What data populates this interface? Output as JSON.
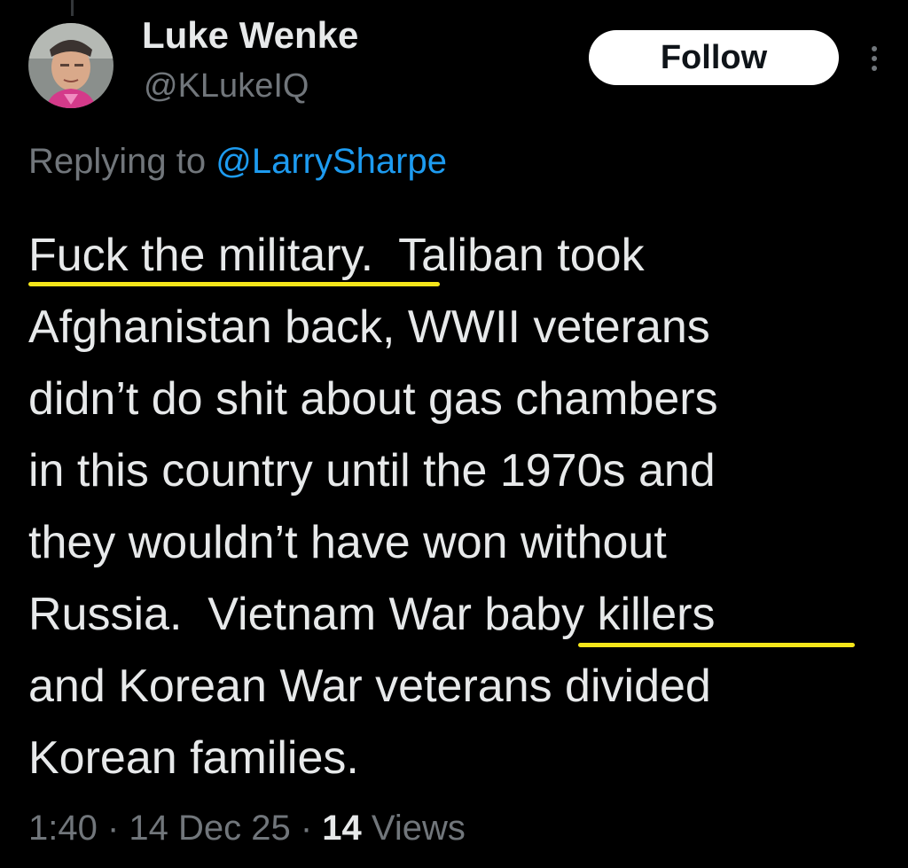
{
  "author": {
    "display_name": "Luke Wenke",
    "handle": "@KLukeIQ",
    "avatar": "profile-photo"
  },
  "actions": {
    "follow_label": "Follow",
    "more_icon": "more-vertical-icon"
  },
  "reply_context": {
    "prefix": "Replying to ",
    "mention": "@LarrySharpe"
  },
  "tweet": {
    "lines": [
      "Fuck the military.  Taliban took",
      "Afghanistan back, WWII veterans",
      "didn’t do shit about gas chambers",
      "in this country until the 1970s and",
      "they wouldn’t have won without",
      "Russia.  Vietnam War baby killers",
      "and Korean War veterans divided",
      "Korean families."
    ],
    "highlighted_phrases": [
      "Fuck the military",
      "baby killers"
    ],
    "highlight_color": "#f5e61a"
  },
  "meta": {
    "time": "1:40",
    "separator": " · ",
    "date": "14 Dec 25",
    "views_count": "14",
    "views_label": " Views"
  },
  "colors": {
    "background": "#000000",
    "text_primary": "#e7e9ea",
    "text_secondary": "#71767b",
    "link": "#1d9bf0",
    "button_bg": "#ffffff"
  }
}
